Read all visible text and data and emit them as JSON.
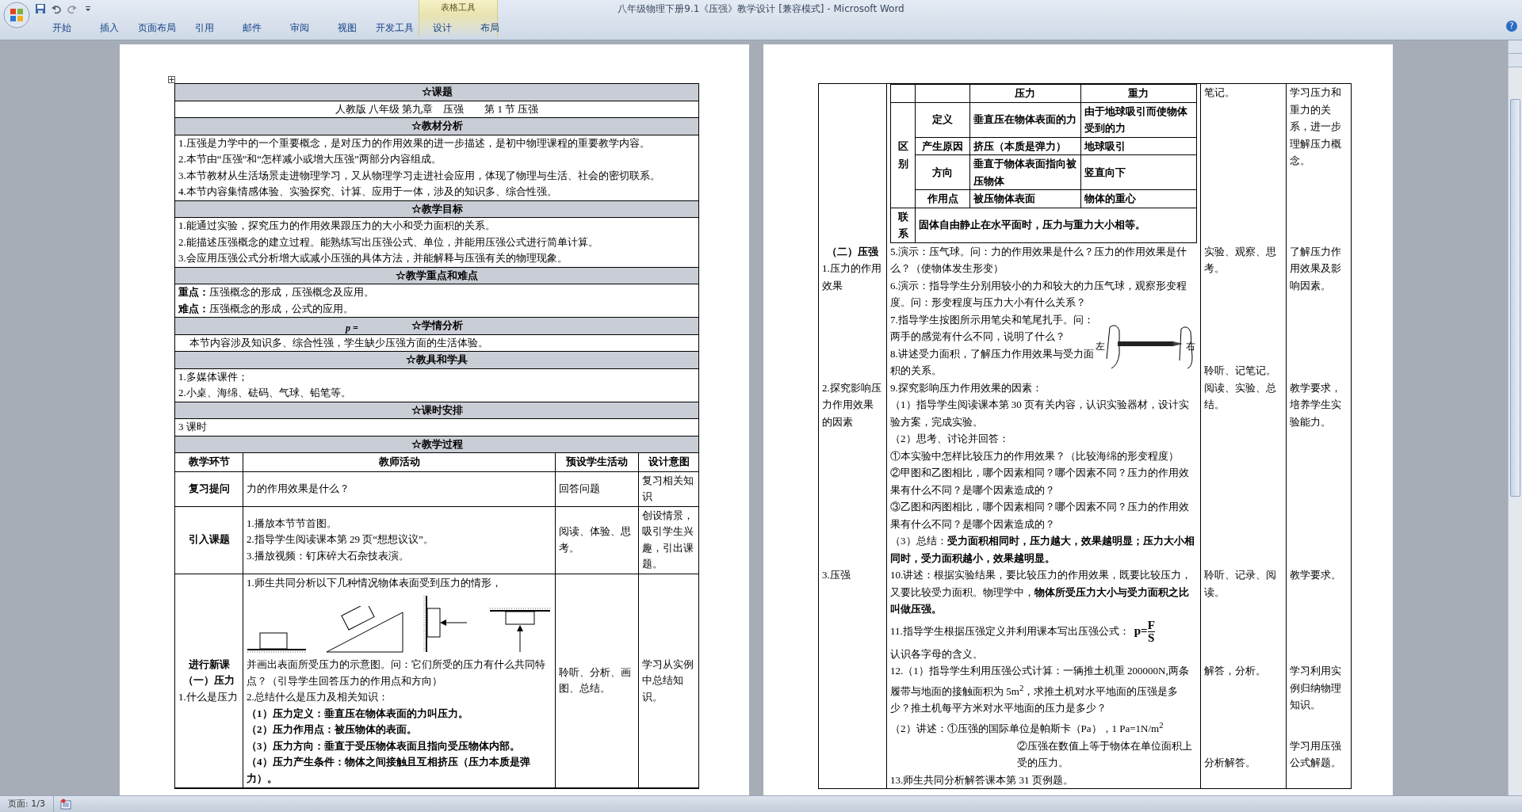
{
  "window": {
    "title": "八年级物理下册9.1《压强》教学设计 [兼容模式] - Microsoft Word",
    "context_group": "表格工具"
  },
  "ribbon_tabs": [
    {
      "label": "开始",
      "selected": false
    },
    {
      "label": "插入",
      "selected": false
    },
    {
      "label": "页面布局",
      "selected": false
    },
    {
      "label": "引用",
      "selected": false
    },
    {
      "label": "邮件",
      "selected": false
    },
    {
      "label": "审阅",
      "selected": false
    },
    {
      "label": "视图",
      "selected": false
    },
    {
      "label": "开发工具",
      "selected": false
    },
    {
      "label": "设计",
      "selected": false
    },
    {
      "label": "布局",
      "selected": false
    }
  ],
  "help": "?",
  "left_page": {
    "sections": [
      {
        "heading": "☆课题",
        "kind": "centered",
        "lines": [
          "人教版 八年级 第九章　压强　　第 1 节 压强"
        ]
      },
      {
        "heading": "☆教材分析",
        "kind": "list",
        "lines": [
          "1.压强是力学中的一个重要概念，是对压力的作用效果的进一步描述，是初中物理课程的重要教学内容。",
          "2.本节由“压强”和“怎样减小或增大压强”两部分内容组成。",
          "3.本节教材从生活场景走进物理学习，又从物理学习走进社会应用，体现了物理与生活、社会的密切联系。",
          "4.本节内容集情感体验、实验探究、计算、应用于一体，涉及的知识多、综合性强。"
        ]
      },
      {
        "heading": "☆教学目标",
        "kind": "list",
        "lines": [
          "1.能通过实验，探究压力的作用效果跟压力的大小和受力面积的关系。",
          "2.能描述压强概念的建立过程。能熟练写出压强公式、单位，并能用压强公式进行简单计算。",
          "3.会应用压强公式分析增大或减小压强的具体方法，并能解释与压强有关的物理现象。"
        ]
      },
      {
        "heading": "☆教学重点和难点",
        "kind": "list",
        "lines": [
          "**重点：**压强概念的形成，压强概念及应用。",
          "**难点：**压强概念的形成，公式的应用。"
        ]
      },
      {
        "heading": "☆学情分析",
        "overlay": "p =",
        "kind": "indented",
        "lines": [
          "本节内容涉及知识多、综合性强，学生缺少压强方面的生活体验。"
        ]
      },
      {
        "heading": "☆教具和学具",
        "kind": "list",
        "lines": [
          "1.多媒体课件；",
          "2.小桌、海绵、砝码、气球、铅笔等。"
        ]
      },
      {
        "heading": "☆课时安排",
        "kind": "list",
        "lines": [
          "3 课时"
        ]
      }
    ],
    "process": {
      "heading": "☆教学过程",
      "columns": [
        "教学环节",
        "教师活动",
        "预设学生活动",
        "设计意图"
      ],
      "rows": [
        {
          "stage": [
            {
              "kind": "heading",
              "text": "复习提问"
            }
          ],
          "teacher": [
            {
              "kind": "text",
              "text": "力的作用效果是什么？"
            }
          ],
          "student": [
            "回答问题"
          ],
          "intent": [
            "复习相关知识"
          ]
        },
        {
          "stage": [
            {
              "kind": "heading",
              "text": "引入课题"
            }
          ],
          "teacher": [
            {
              "kind": "text",
              "text": "1.播放本节节首图。"
            },
            {
              "kind": "text",
              "text": "2.指导学生阅读课本第 29 页“想想议议”。"
            },
            {
              "kind": "text",
              "text": "3.播放视频：钉床碎大石杂技表演。"
            }
          ],
          "student": [
            "阅读、体验、思考。"
          ],
          "intent": [
            "创设情景，吸引学生兴趣，引出课题。"
          ]
        },
        {
          "stage": [
            {
              "kind": "heading",
              "text": "进行新课"
            },
            {
              "kind": "heading",
              "text": "（一）压力"
            },
            {
              "kind": "item",
              "text": "1.什么是压力"
            }
          ],
          "teacher": [
            {
              "kind": "text",
              "text": "1.师生共同分析以下几种情况物体表面受到压力的情形，"
            },
            {
              "kind": "diagrams"
            },
            {
              "kind": "text",
              "text": "并画出表面所受压力的示意图。问：它们所受的压力有什么共同特点？（引导学生回答压力的作用点和方向）"
            },
            {
              "kind": "text",
              "text": "2.总结什么是压力及相关知识："
            },
            {
              "kind": "bold",
              "text": "（1）压力定义：垂直压在物体表面的力叫压力。"
            },
            {
              "kind": "bold",
              "text": "（2）压力作用点：被压物体的表面。"
            },
            {
              "kind": "bold",
              "text": "（3）压力方向：垂直于受压物体表面且指向受压物体内部。"
            },
            {
              "kind": "bold",
              "text": "（4）压力产生条件：物体之间接触且互相挤压（压力本质是弹力）。"
            }
          ],
          "student": [
            "聆听、分析、画图、总结。"
          ],
          "intent": [
            "学习从实例中总结知识。"
          ]
        }
      ]
    }
  },
  "right_page": {
    "rows": [
      {
        "stage": [],
        "teacher": [
          {
            "kind": "comparison",
            "header": [
              "压力",
              "重力"
            ],
            "group": "区别",
            "rows": [
              {
                "aspect": "定义",
                "pressure": "垂直压在物体表面的力",
                "gravity": "由于地球吸引而使物体受到的力"
              },
              {
                "aspect": "产生原因",
                "pressure": "挤压（本质是弹力）",
                "gravity": "地球吸引"
              },
              {
                "aspect": "方向",
                "pressure": "垂直于物体表面指向被压物体",
                "gravity": "竖直向下"
              },
              {
                "aspect": "作用点",
                "pressure": "被压物体表面",
                "gravity": "物体的重心"
              }
            ],
            "link_label": "联系",
            "link_text": "固体自由静止在水平面时，压力与重力大小相等。"
          }
        ],
        "student": [
          "笔记。"
        ],
        "intent": [
          "学习压力和重力的关系，进一步理解压力概念。"
        ]
      },
      {
        "stage": [
          {
            "kind": "heading",
            "text": "（二）压强"
          },
          {
            "kind": "item",
            "text": "1.压力的作用效果"
          }
        ],
        "teacher": [
          {
            "kind": "text",
            "text": "5.演示：压气球。问：力的作用效果是什么？压力的作用效果是什么？（使物体发生形变）"
          },
          {
            "kind": "text",
            "text": "6.演示：指导学生分别用较小的力和较大的力压气球，观察形变程度。问：形变程度与压力大小有什么关系？"
          },
          {
            "kind": "figure",
            "texts": [
              "7.指导学生按图所示用笔尖和笔尾扎手。问：两手的感觉有什么不同，说明了什么？",
              "8.讲述受力面积，了解压力作用效果与受力面积的关系。"
            ],
            "labels": [
              "左",
              "右"
            ]
          }
        ],
        "student": [
          "实验、观察、思考。",
          "聆听、记笔记。"
        ],
        "intent": [
          "了解压力作用效果及影响因素。"
        ]
      },
      {
        "stage": [
          {
            "kind": "item",
            "text": "2.探究影响压力作用效果的因素"
          }
        ],
        "teacher": [
          {
            "kind": "text",
            "text": "9.探究影响压力作用效果的因素："
          },
          {
            "kind": "text",
            "text": "（1）指导学生阅读课本第 30 页有关内容，认识实验器材，设计实验方案，完成实验。"
          },
          {
            "kind": "text",
            "text": "（2）思考、讨论并回答："
          },
          {
            "kind": "text",
            "text": "①本实验中怎样比较压力的作用效果？（比较海绵的形变程度）"
          },
          {
            "kind": "text",
            "text": "②甲图和乙图相比，哪个因素相同？哪个因素不同？压力的作用效果有什么不同？是哪个因素造成的？"
          },
          {
            "kind": "text",
            "text": "③乙图和丙图相比，哪个因素相同？哪个因素不同？压力的作用效果有什么不同？是哪个因素造成的？"
          },
          {
            "kind": "text",
            "text": "（3）总结：**受力面积相同时，压力越大，效果越明显；压力大小相同时，受力面积越小，效果越明显。**"
          }
        ],
        "student": [
          "阅读、实验、总结。"
        ],
        "intent": [
          "教学要求，培养学生实验能力。"
        ]
      },
      {
        "stage": [
          {
            "kind": "item",
            "text": "3.压强"
          }
        ],
        "teacher": [
          {
            "kind": "text",
            "text": "10.讲述：根据实验结果，要比较压力的作用效果，既要比较压力，又要比较受力面积。物理学中，**物体所受压力大小与受力面积之比叫做压强。**"
          },
          {
            "kind": "formula",
            "text": "11.指导学生根据压强定义并利用课本写出压强公式：",
            "lhs": "p=",
            "numerator": "F",
            "denominator": "S"
          },
          {
            "kind": "text",
            "text": "认识各字母的含义。"
          }
        ],
        "student": [
          "聆听、记录、阅读。"
        ],
        "intent": [
          "教学要求。"
        ]
      },
      {
        "stage": [],
        "teacher": [
          {
            "kind": "text",
            "text": "12.（1）指导学生利用压强公式计算：一辆推土机重 200000N,两条履带与地面的接触面积为 5m$^{2}$，求推土机对水平地面的压强是多少？推土机每平方米对水平地面的压力是多少？"
          },
          {
            "kind": "text",
            "text": "（2）讲述：①压强的国际单位是帕斯卡（Pa），1 Pa=1N/m$^{2}$"
          },
          {
            "kind": "indent",
            "text": "②压强在数值上等于物体在单位面积上受的压力。"
          }
        ],
        "student": [
          "解答，分析。",
          "分析解答。"
        ],
        "intent": [
          "学习利用实例归纳物理知识。",
          "学习用压强公式解题。"
        ]
      },
      {
        "stage": [],
        "teacher": [
          {
            "kind": "text",
            "text": "13.师生共同分析解答课本第 31 页例题。"
          }
        ],
        "student": [],
        "intent": []
      }
    ]
  },
  "status_bar": {
    "page": "页面: 1/3"
  }
}
